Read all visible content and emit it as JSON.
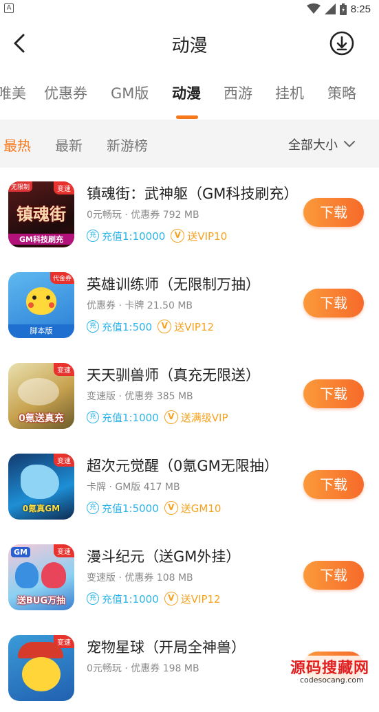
{
  "status_bar": {
    "time": "8:25",
    "left_glyph": "A"
  },
  "header": {
    "title": "动漫"
  },
  "tabs": [
    {
      "label": "唯美"
    },
    {
      "label": "优惠券"
    },
    {
      "label": "GM版"
    },
    {
      "label": "动漫",
      "active": true
    },
    {
      "label": "西游"
    },
    {
      "label": "挂机"
    },
    {
      "label": "策略"
    }
  ],
  "filters": {
    "items": [
      "最热",
      "最新",
      "新游榜"
    ],
    "selected": "最热",
    "size_filter": "全部大小"
  },
  "games": [
    {
      "title": "镇魂街：武神躯（GM科技刷充）",
      "meta": "0元畅玩 · 优惠券  792 MB",
      "tag1": "充值1:10000",
      "tag2": "送VIP10",
      "icon_text": "镇魂街",
      "icon_badge": "变速",
      "icon_bottom": "GM科技刷充"
    },
    {
      "title": "英雄训练师（无限制万抽）",
      "meta": "优惠券 · 卡牌  21.50 MB",
      "tag1": "充值1:500",
      "tag2": "送VIP12",
      "icon_text": "",
      "icon_badge": "代金券",
      "icon_bottom": "脚本版"
    },
    {
      "title": "天天驯兽师（真充无限送）",
      "meta": "变速版 · 优惠券  385 MB",
      "tag1": "充值1:1000",
      "tag2": "送满级VIP",
      "icon_text": "",
      "icon_badge": "变速",
      "icon_bottom": "0氪送真充"
    },
    {
      "title": "超次元觉醒（0氪GM无限抽）",
      "meta": "卡牌 · GM版  417 MB",
      "tag1": "充值1:5000",
      "tag2": "送GM10",
      "icon_text": "",
      "icon_badge": "变速",
      "icon_bottom": "0氪真GM"
    },
    {
      "title": "漫斗纪元（送GM外挂）",
      "meta": "变速版 · 优惠券  108 MB",
      "tag1": "充值1:1000",
      "tag2": "送VIP12",
      "icon_text": "GM",
      "icon_badge": "变速",
      "icon_bottom": "送BUG万抽"
    },
    {
      "title": "宠物星球（开局全神兽）",
      "meta": "0元畅玩 · 优惠券  198 MB",
      "tag1": "",
      "tag2": "",
      "icon_text": "",
      "icon_badge": "变速",
      "icon_bottom": ""
    }
  ],
  "labels": {
    "download": "下载",
    "tag1_glyph": "充",
    "tag2_glyph": "V"
  },
  "watermark": {
    "main": "源码搜藏网",
    "sub": "codesocang.com"
  },
  "colors": {
    "accent": "#f7781b",
    "tag_blue": "#2db3e8",
    "tag_gold": "#f6a21e",
    "button_from": "#fb9a3b",
    "button_to": "#f66a2a"
  }
}
